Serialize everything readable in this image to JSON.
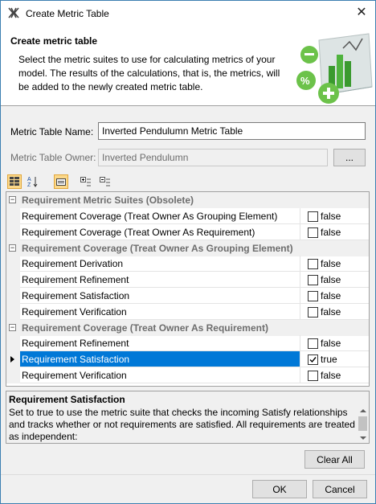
{
  "window": {
    "title": "Create Metric Table"
  },
  "header": {
    "title": "Create metric table",
    "description": "Select the metric suites to use for calculating metrics of your model. The results of the calculations, that is, the metrics, will be added to the newly created metric table."
  },
  "form": {
    "name_label": "Metric Table Name:",
    "name_value": "Inverted Pendulumn Metric Table",
    "owner_label": "Metric Table Owner:",
    "owner_value": "Inverted Pendulumn",
    "browse_label": "..."
  },
  "groups": [
    {
      "title": "Requirement Metric Suites (Obsolete)",
      "rows": [
        {
          "label": "Requirement Coverage (Treat Owner As Grouping Element)",
          "value": "false",
          "checked": false
        },
        {
          "label": "Requirement Coverage (Treat Owner As Requirement)",
          "value": "false",
          "checked": false
        }
      ]
    },
    {
      "title": "Requirement Coverage (Treat Owner As Grouping Element)",
      "rows": [
        {
          "label": "Requirement Derivation",
          "value": "false",
          "checked": false
        },
        {
          "label": "Requirement Refinement",
          "value": "false",
          "checked": false
        },
        {
          "label": "Requirement Satisfaction",
          "value": "false",
          "checked": false
        },
        {
          "label": "Requirement Verification",
          "value": "false",
          "checked": false
        }
      ]
    },
    {
      "title": "Requirement Coverage (Treat Owner As Requirement)",
      "rows": [
        {
          "label": "Requirement Refinement",
          "value": "false",
          "checked": false
        },
        {
          "label": "Requirement Satisfaction",
          "value": "true",
          "checked": true
        },
        {
          "label": "Requirement Verification",
          "value": "false",
          "checked": false
        }
      ]
    }
  ],
  "description_panel": {
    "title": "Requirement Satisfaction",
    "text": "Set to true to use the metric suite that checks the incoming Satisfy relationships and tracks whether or not requirements are satisfied. All requirements are treated as independent:"
  },
  "buttons": {
    "clear_all": "Clear All",
    "ok": "OK",
    "cancel": "Cancel"
  },
  "colors": {
    "selection": "#0078d7",
    "accent": "#3c7fb1"
  }
}
